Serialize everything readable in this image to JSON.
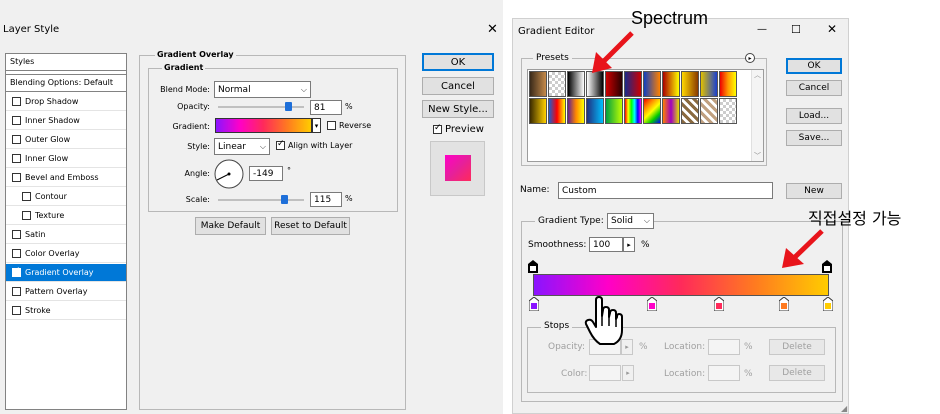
{
  "layer_style": {
    "title": "Layer Style",
    "close_glyph": "✕",
    "styles_header": "Styles",
    "blending_options": "Blending Options: Default",
    "styles": [
      {
        "label": "Drop Shadow",
        "checked": false,
        "indent": false,
        "selected": false
      },
      {
        "label": "Inner Shadow",
        "checked": false,
        "indent": false,
        "selected": false
      },
      {
        "label": "Outer Glow",
        "checked": false,
        "indent": false,
        "selected": false
      },
      {
        "label": "Inner Glow",
        "checked": false,
        "indent": false,
        "selected": false
      },
      {
        "label": "Bevel and Emboss",
        "checked": false,
        "indent": false,
        "selected": false
      },
      {
        "label": "Contour",
        "checked": false,
        "indent": true,
        "selected": false
      },
      {
        "label": "Texture",
        "checked": false,
        "indent": true,
        "selected": false
      },
      {
        "label": "Satin",
        "checked": false,
        "indent": false,
        "selected": false
      },
      {
        "label": "Color Overlay",
        "checked": false,
        "indent": false,
        "selected": false
      },
      {
        "label": "Gradient Overlay",
        "checked": true,
        "indent": false,
        "selected": true
      },
      {
        "label": "Pattern Overlay",
        "checked": false,
        "indent": false,
        "selected": false
      },
      {
        "label": "Stroke",
        "checked": false,
        "indent": false,
        "selected": false
      }
    ],
    "panel_title": "Gradient Overlay",
    "group_title": "Gradient",
    "blend_mode_label": "Blend Mode:",
    "blend_mode_value": "Normal",
    "opacity_label": "Opacity:",
    "opacity_value": "81",
    "opacity_fraction": 0.81,
    "percent": "%",
    "gradient_label": "Gradient:",
    "reverse_label": "Reverse",
    "style_label": "Style:",
    "style_value": "Linear",
    "align_label": "Align with Layer",
    "angle_label": "Angle:",
    "angle_value": "-149",
    "degree": "°",
    "scale_label": "Scale:",
    "scale_value": "115",
    "scale_fraction": 0.77,
    "make_default": "Make Default",
    "reset_default": "Reset to Default",
    "ok": "OK",
    "cancel": "Cancel",
    "new_style": "New Style...",
    "preview_label": "Preview"
  },
  "gradient_editor": {
    "title": "Gradient Editor",
    "min_glyph": "—",
    "max_glyph": "☐",
    "close_glyph": "✕",
    "presets_label": "Presets",
    "ok": "OK",
    "cancel": "Cancel",
    "load": "Load...",
    "save": "Save...",
    "name_label": "Name:",
    "name_value": "Custom",
    "new_button": "New",
    "gradient_type_label": "Gradient Type:",
    "gradient_type_value": "Solid",
    "smoothness_label": "Smoothness:",
    "smoothness_value": "100",
    "percent": "%",
    "stops_label": "Stops",
    "opacity_label": "Opacity:",
    "location_label": "Location:",
    "color_label": "Color:",
    "delete_label": "Delete"
  },
  "annotations": {
    "spectrum": "Spectrum",
    "korean_note": "직접설정 가능",
    "arrow_color": "#e8141b"
  },
  "colors": {
    "gradient_stops": [
      "#8a14ff",
      "#ff00c8",
      "#ff2a5a",
      "#ff7a20",
      "#ffcc00"
    ],
    "selection": "#0078d7",
    "preview_swatch": "#e6209a"
  }
}
